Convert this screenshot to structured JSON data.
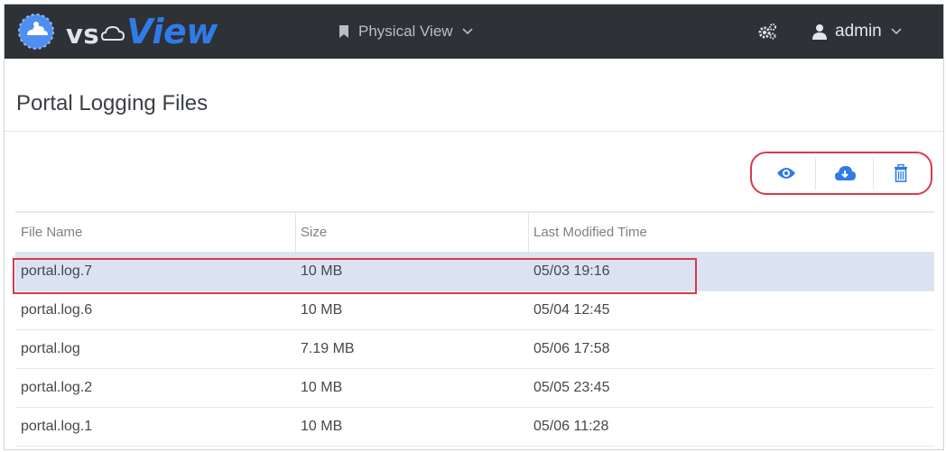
{
  "brand": {
    "logo_prefix": "vs",
    "logo_main": "View",
    "colors": {
      "navbar": "#2e3135",
      "accent": "#2f7bea",
      "highlight": "#d93a4a",
      "selected_row": "#dbe3f2"
    }
  },
  "navbar": {
    "view_menu": {
      "icon": "bookmark-icon",
      "label": "Physical View"
    },
    "settings_icon": "gears-icon",
    "user_menu": {
      "icon": "user-icon",
      "label": "admin"
    }
  },
  "page": {
    "title": "Portal Logging Files"
  },
  "actions": [
    {
      "name": "view",
      "icon": "eye-icon"
    },
    {
      "name": "download",
      "icon": "cloud-download-icon"
    },
    {
      "name": "delete",
      "icon": "trash-icon"
    }
  ],
  "table": {
    "columns": [
      "File Name",
      "Size",
      "Last Modified Time"
    ],
    "rows": [
      {
        "name": "portal.log.7",
        "size": "10 MB",
        "modified": "05/03 19:16",
        "selected": true
      },
      {
        "name": "portal.log.6",
        "size": "10 MB",
        "modified": "05/04 12:45",
        "selected": false
      },
      {
        "name": "portal.log",
        "size": "7.19 MB",
        "modified": "05/06 17:58",
        "selected": false
      },
      {
        "name": "portal.log.2",
        "size": "10 MB",
        "modified": "05/05 23:45",
        "selected": false
      },
      {
        "name": "portal.log.1",
        "size": "10 MB",
        "modified": "05/06 11:28",
        "selected": false
      }
    ]
  }
}
